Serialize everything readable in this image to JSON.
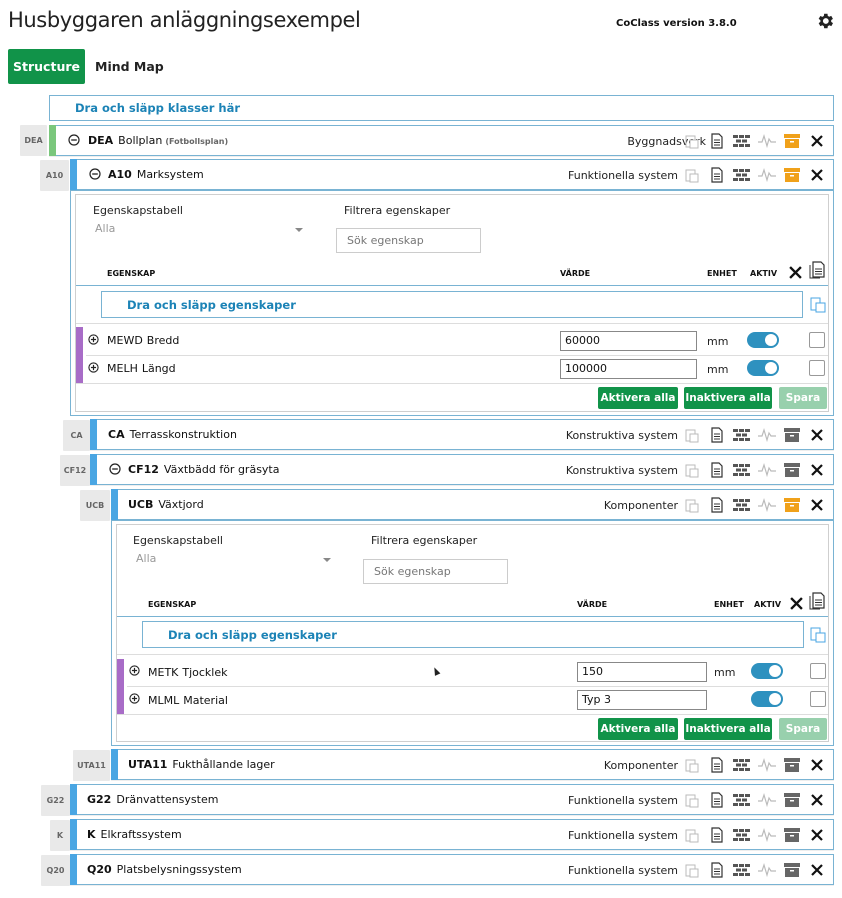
{
  "app": {
    "title": "Husbyggaren anläggningsexempel",
    "version": "CoClass version 3.8.0"
  },
  "tabs": [
    {
      "label": "Structure",
      "active": true
    },
    {
      "label": "Mind Map",
      "active": false
    }
  ],
  "dropzone_label": "Dra och släpp klasser här",
  "colors": {
    "accent_green": "#119349",
    "row_border": "#79b3d3",
    "class_bar": "#4aa6e3",
    "root_bar": "#7ac77c",
    "property_bar": "#a86cc7",
    "toggle": "#2e91bf",
    "archive_orange": "#f0a11a"
  },
  "rows": [
    {
      "tag": "DEA",
      "code": "DEA",
      "name": "Bollplan",
      "subname": "(Fotbollsplan)",
      "category": "Byggnadsverk",
      "expanded": true,
      "archive_active": true
    },
    {
      "tag": "A10",
      "code": "A10",
      "name": "Marksystem",
      "category": "Funktionella system",
      "expanded": true,
      "archive_active": true
    },
    {
      "tag": "CA",
      "code": "CA",
      "name": "Terrasskonstruktion",
      "category": "Konstruktiva system",
      "expanded": false,
      "archive_active": false
    },
    {
      "tag": "CF12",
      "code": "CF12",
      "name": "Växtbädd för gräsyta",
      "category": "Konstruktiva system",
      "expanded": true,
      "archive_active": false
    },
    {
      "tag": "UCB",
      "code": "UCB",
      "name": "Växtjord",
      "category": "Komponenter",
      "expanded": true,
      "archive_active": true
    },
    {
      "tag": "UTA11",
      "code": "UTA11",
      "name": "Fukthållande lager",
      "category": "Komponenter",
      "expanded": false,
      "archive_active": false
    },
    {
      "tag": "G22",
      "code": "G22",
      "name": "Dränvattensystem",
      "category": "Funktionella system",
      "expanded": false,
      "archive_active": false
    },
    {
      "tag": "K",
      "code": "K",
      "name": "Elkraftssystem",
      "category": "Funktionella system",
      "expanded": false,
      "archive_active": false
    },
    {
      "tag": "Q20",
      "code": "Q20",
      "name": "Platsbelysningssystem",
      "category": "Funktionella system",
      "expanded": false,
      "archive_active": false
    }
  ],
  "panels": [
    {
      "table_label": "Egenskapstabell",
      "table_value": "Alla",
      "filter_label": "Filtrera egenskaper",
      "search_placeholder": "Sök egenskap",
      "headers": {
        "property": "EGENSKAP",
        "value": "VÄRDE",
        "unit": "ENHET",
        "active": "AKTIV"
      },
      "dropzone_label": "Dra och släpp egenskaper",
      "properties": [
        {
          "code": "MEWD",
          "name": "Bredd",
          "value": "60000",
          "unit": "mm",
          "active": true
        },
        {
          "code": "MELH",
          "name": "Längd",
          "value": "100000",
          "unit": "mm",
          "active": true
        }
      ],
      "buttons": {
        "activate_all": "Aktivera alla",
        "deactivate_all": "Inaktivera alla",
        "save": "Spara"
      }
    },
    {
      "table_label": "Egenskapstabell",
      "table_value": "Alla",
      "filter_label": "Filtrera egenskaper",
      "search_placeholder": "Sök egenskap",
      "headers": {
        "property": "EGENSKAP",
        "value": "VÄRDE",
        "unit": "ENHET",
        "active": "AKTIV"
      },
      "dropzone_label": "Dra och släpp egenskaper",
      "properties": [
        {
          "code": "METK",
          "name": "Tjocklek",
          "value": "150",
          "unit": "mm",
          "active": true
        },
        {
          "code": "MLML",
          "name": "Material",
          "value": "Typ 3",
          "unit": "",
          "active": true
        }
      ],
      "buttons": {
        "activate_all": "Aktivera alla",
        "deactivate_all": "Inaktivera alla",
        "save": "Spara"
      }
    }
  ]
}
